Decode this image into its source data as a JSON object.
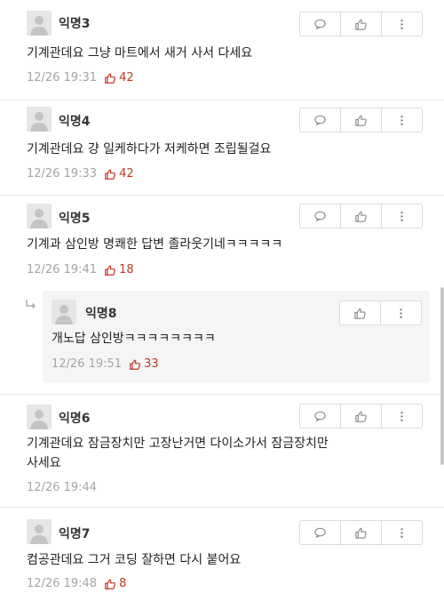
{
  "comments": [
    {
      "author": "익명3",
      "text": "기계관데요 그냥 마트에서 새거 사서 다세요",
      "time": "12/26 19:31",
      "likes": "42"
    },
    {
      "author": "익명4",
      "text": "기계관데요 걍 일케하다가 저케하면 조립될걸요",
      "time": "12/26 19:33",
      "likes": "42"
    },
    {
      "author": "익명5",
      "text": "기계과 삼인방 명쾌한 답변 졸라웃기네ㅋㅋㅋㅋㅋ",
      "time": "12/26 19:41",
      "likes": "18"
    },
    {
      "author": "익명6",
      "text_line1": "기계관데요 잠금장치만 고장난거면 다이소가서 잠금장치만",
      "text_line2": "사세요",
      "time": "12/26 19:44"
    },
    {
      "author": "익명7",
      "text": "컴공관데요 그거 코딩 잘하면 다시 붙어요",
      "time": "12/26 19:48",
      "likes": "8"
    }
  ],
  "reply": {
    "author": "익명8",
    "text": "개노답 삼인방ㅋㅋㅋㅋㅋㅋㅋㅋ",
    "time": "12/26 19:51",
    "likes": "33"
  },
  "icons": {
    "reply": "speech-bubble-icon",
    "like": "thumbs-up-icon",
    "more": "more-vertical-icon",
    "reply_indent": "reply-arrow-icon",
    "avatar": "default-avatar-icon"
  },
  "colors": {
    "like_count": "#c0392b",
    "meta": "#a5a5a5",
    "reply_bg": "#f5f5f5"
  }
}
